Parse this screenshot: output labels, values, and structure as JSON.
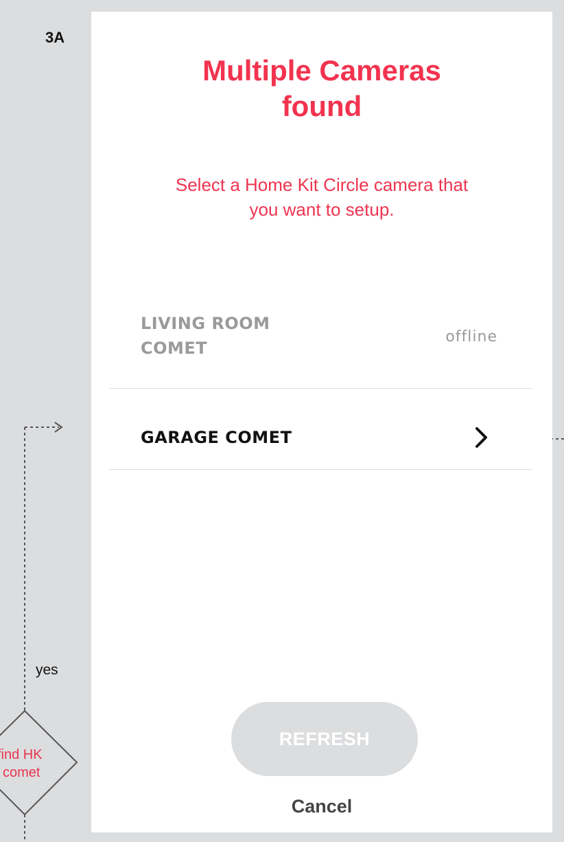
{
  "flow": {
    "step_label": "3A",
    "yes_label": "yes",
    "decision_line1": "find HK",
    "decision_line2": "comet"
  },
  "screen": {
    "title": "Multiple Cameras found",
    "subtitle": "Select a Home Kit Circle camera that you want to setup.",
    "cameras": [
      {
        "name": "LIVING ROOM COMET",
        "status": "offline",
        "available": false
      },
      {
        "name": "GARAGE COMET",
        "status": "",
        "available": true,
        "icon": "chevron-right-icon"
      }
    ],
    "refresh_label": "REFRESH",
    "cancel_label": "Cancel"
  },
  "colors": {
    "accent": "#f2334f",
    "background": "#dcdddf",
    "disabled_button": "#dcdddf",
    "muted_text": "#9a9a9a"
  }
}
